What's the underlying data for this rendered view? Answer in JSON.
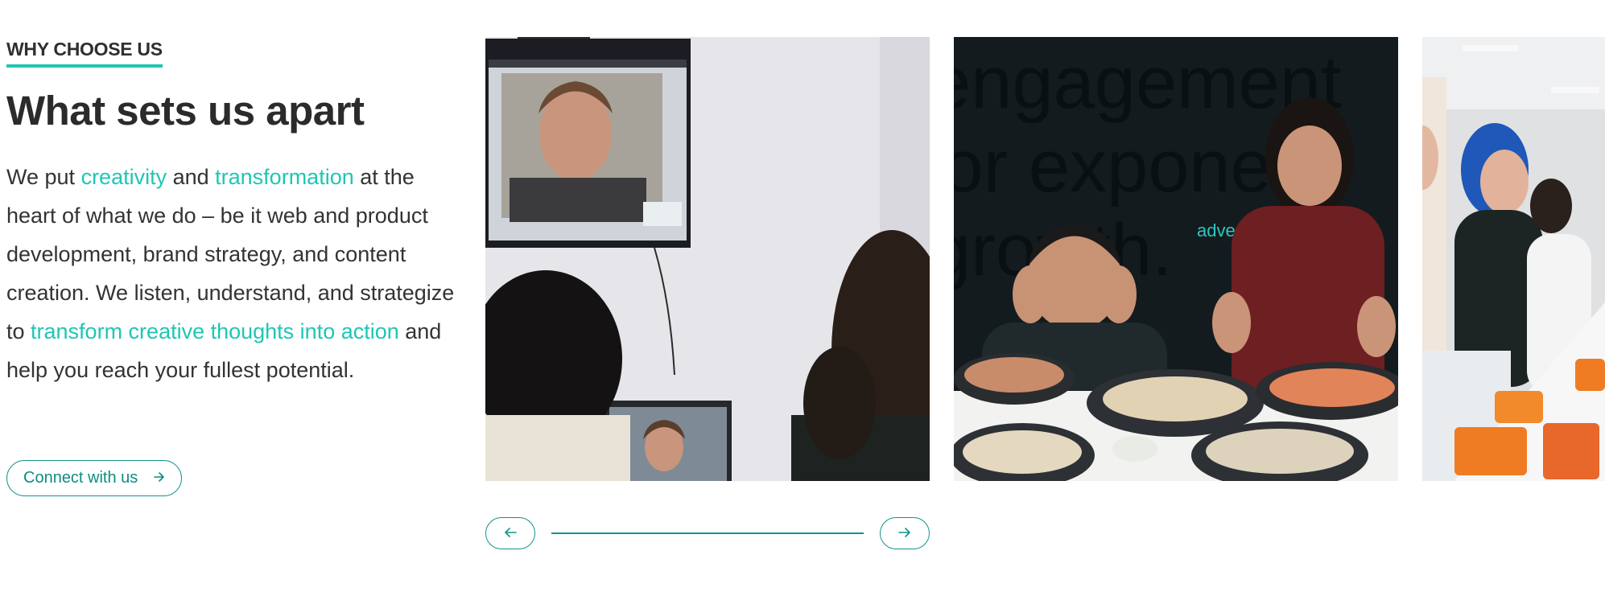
{
  "section": {
    "eyebrow": "WHY CHOOSE US",
    "heading": "What sets us apart",
    "paragraph": {
      "p1": "We put ",
      "h1": "creativity",
      "p2": " and ",
      "h2": "transformation",
      "p3": " at the heart of what we do – be it web and product development, brand strategy, and content creation. We listen, understand, and strategize to ",
      "h3": "transform creative thoughts into action",
      "p4": " and help you reach your fullest potential."
    },
    "cta_label": "Connect with us",
    "cta_icon": "arrow-right-icon"
  },
  "carousel": {
    "slide2_wall_text": [
      "engagement",
      "for exponenti",
      "growth."
    ],
    "slide2_brand_text": "adve",
    "prev_icon": "arrow-left-icon",
    "next_icon": "arrow-right-icon"
  },
  "colors": {
    "accent": "#1fc6b4",
    "button": "#11948b",
    "text": "#333333"
  }
}
